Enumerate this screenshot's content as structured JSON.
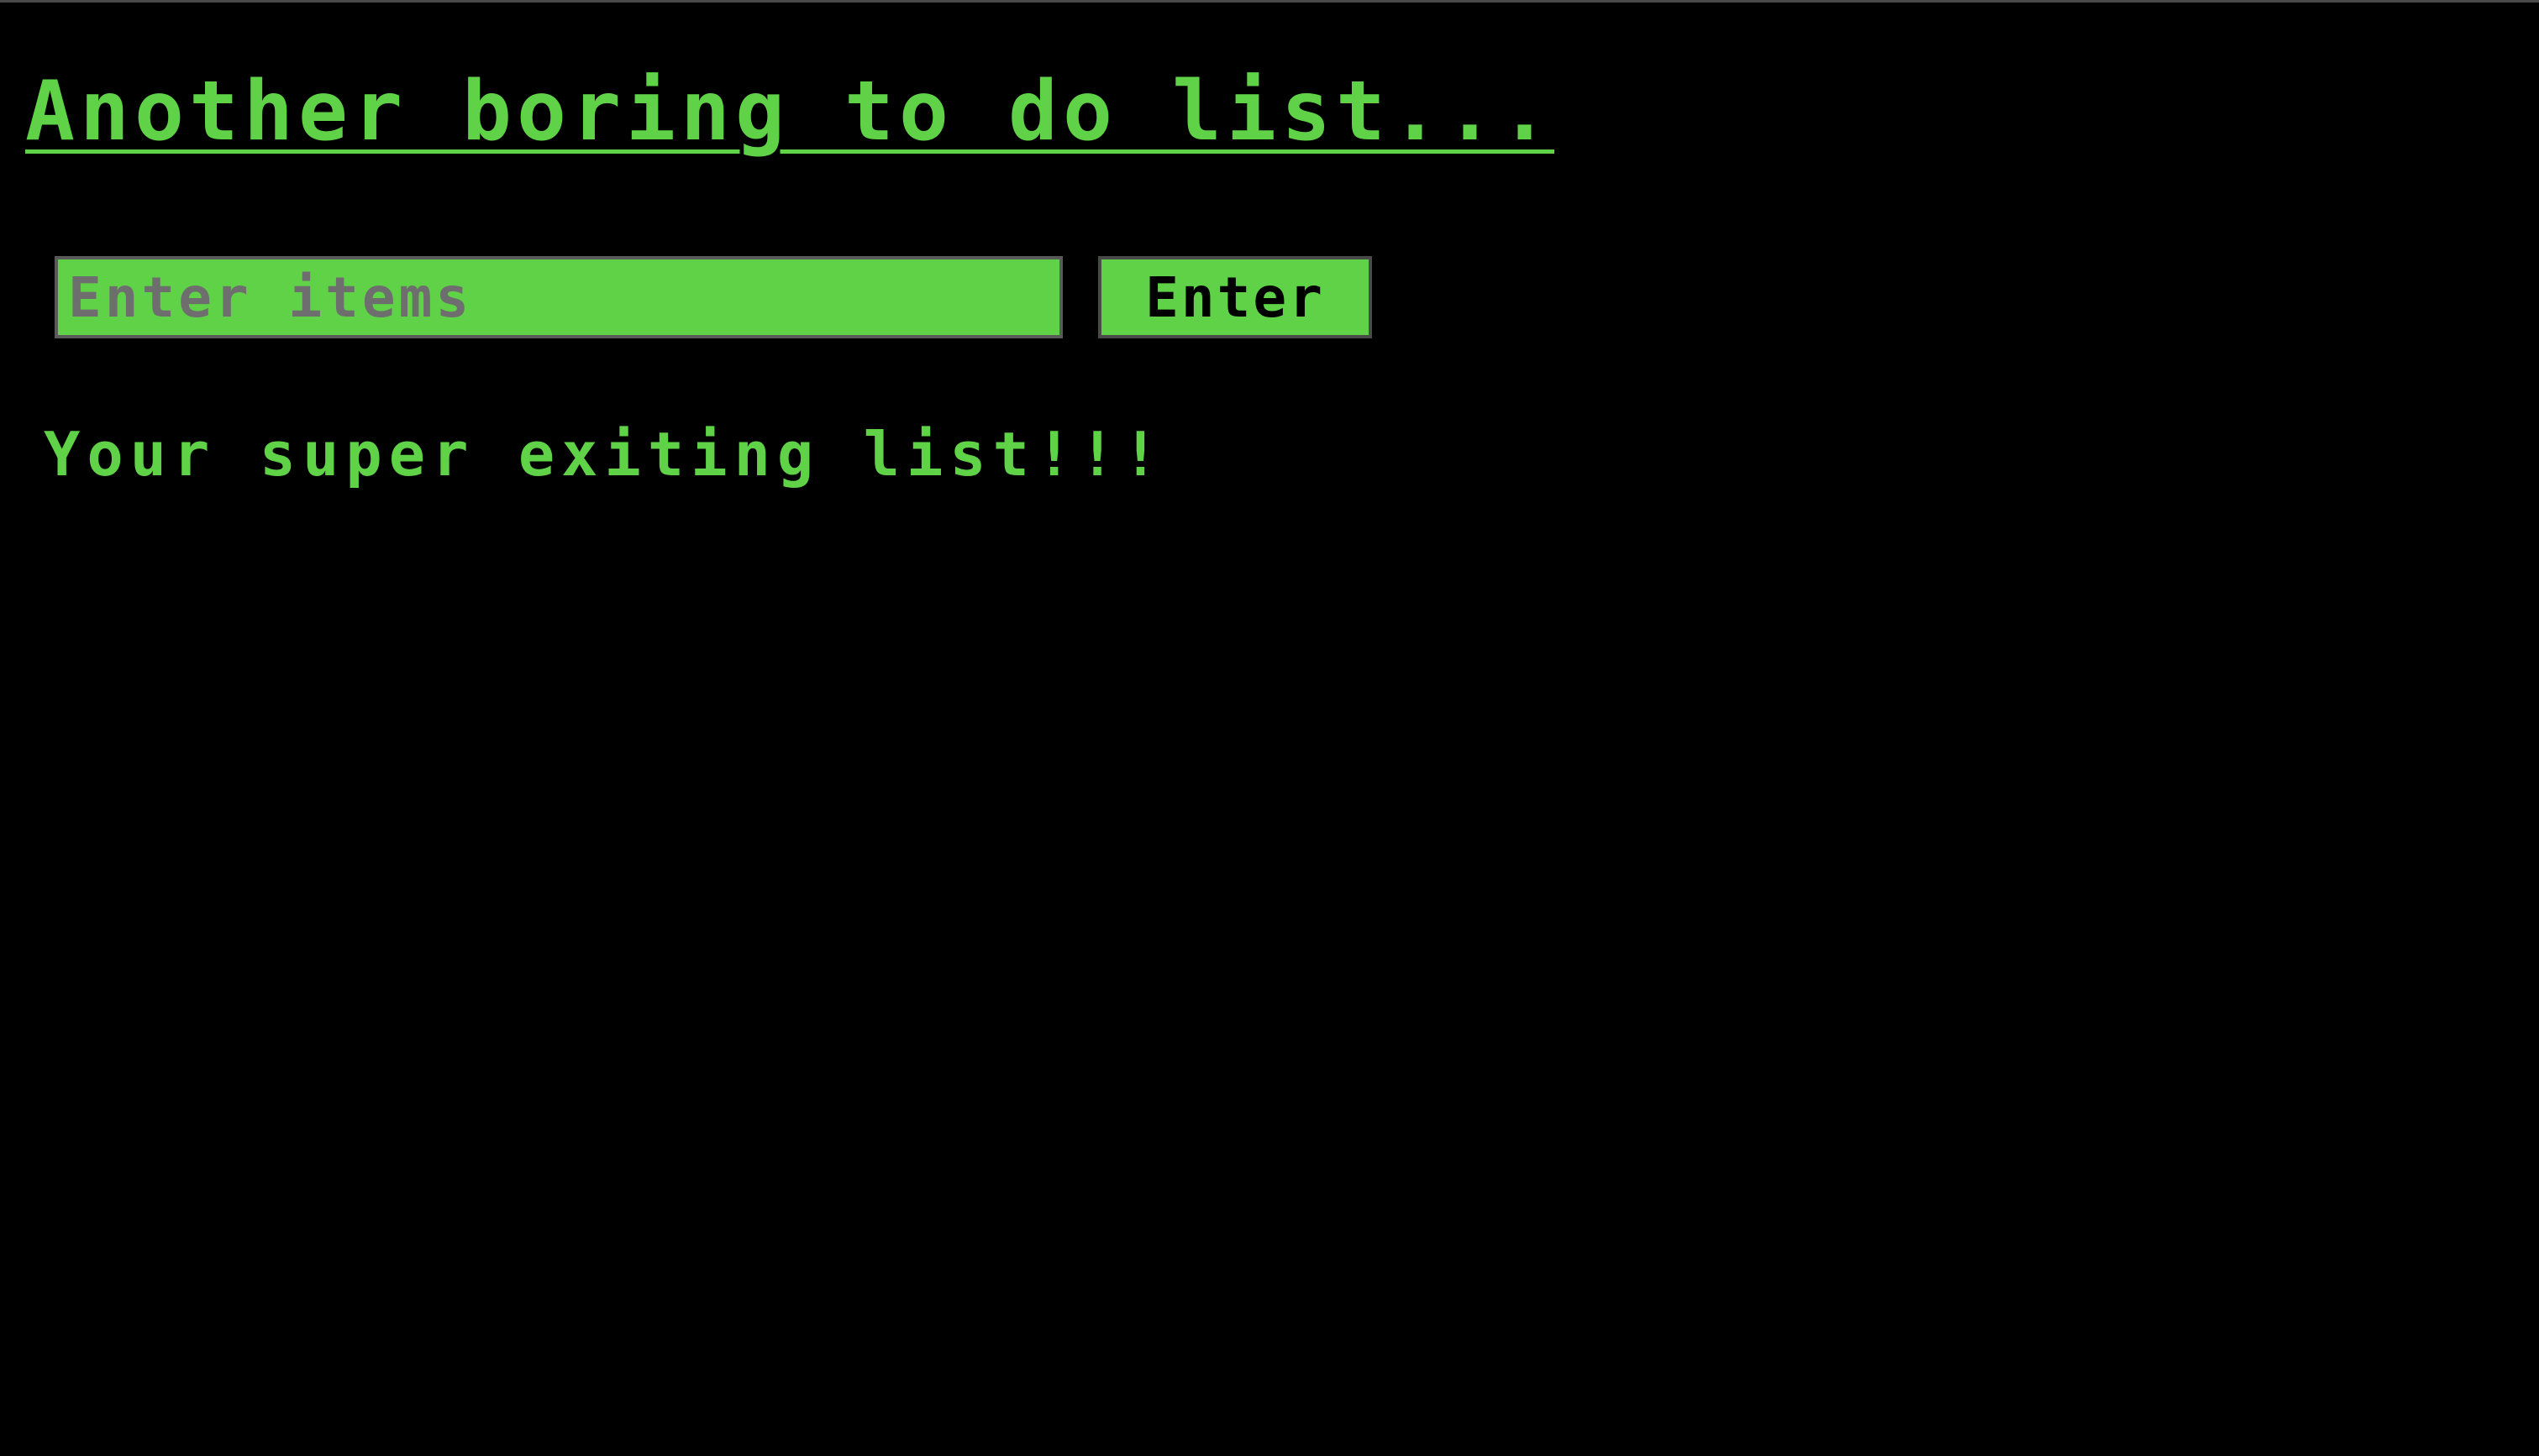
{
  "header": {
    "title": "Another boring to do list..."
  },
  "form": {
    "input_value": "",
    "input_placeholder": "Enter items",
    "submit_label": "Enter"
  },
  "list": {
    "heading": "Your super exiting list!!!",
    "items": []
  },
  "theme": {
    "accent": "#5fd247",
    "background": "#000000",
    "placeholder": "#6e6e6e"
  }
}
